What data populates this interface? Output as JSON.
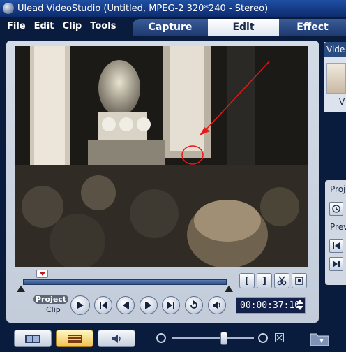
{
  "window": {
    "title": "Ulead VideoStudio (Untitled, MPEG-2 320*240 - Stereo)"
  },
  "menu": [
    "File",
    "Edit",
    "Clip",
    "Tools"
  ],
  "tabs": {
    "capture": "Capture",
    "edit": "Edit",
    "effect": "Effect"
  },
  "library": {
    "tab": "Vide",
    "thumb_caption": "V"
  },
  "options": {
    "project": "Proj",
    "preview": "Prev"
  },
  "playback": {
    "project_label": "Project",
    "clip_label": "Clip",
    "timecode": "00:00:37:10"
  },
  "trim": {
    "mark_in": "[",
    "mark_out": "]"
  },
  "colors": {
    "accent": "#f0c24f",
    "annotation": "#e81818",
    "dark_bg": "#0a1c3e"
  }
}
